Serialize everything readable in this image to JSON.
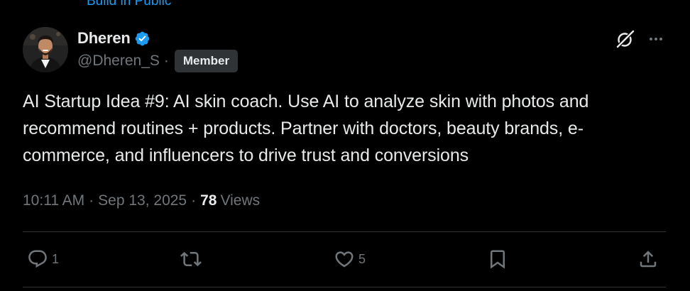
{
  "community": {
    "label": "Build in Public"
  },
  "author": {
    "display_name": "Dheren",
    "handle": "@Dheren_S",
    "separator": "·",
    "badge": "Member",
    "verified_color": "#1d9bf0"
  },
  "post": {
    "text": "AI Startup Idea #9: AI skin coach. Use AI to analyze skin with photos and recommend routines + products. Partner with doctors, beauty brands, e-commerce, and influencers to drive trust and conversions",
    "time": "10:11 AM",
    "date": "Sep 13, 2025",
    "views_count": "78",
    "views_label": "Views",
    "meta_separator": "·"
  },
  "actions": {
    "reply_count": "1",
    "like_count": "5"
  },
  "icons": {
    "top_right": [
      "grok-icon",
      "more-icon"
    ],
    "action_bar": [
      "reply-icon",
      "repost-icon",
      "like-icon",
      "bookmark-icon",
      "share-icon"
    ]
  },
  "colors": {
    "background": "#000000",
    "text_primary": "#e7e9ea",
    "text_secondary": "#71767b",
    "accent": "#1d9bf0",
    "border": "#2f3336"
  }
}
